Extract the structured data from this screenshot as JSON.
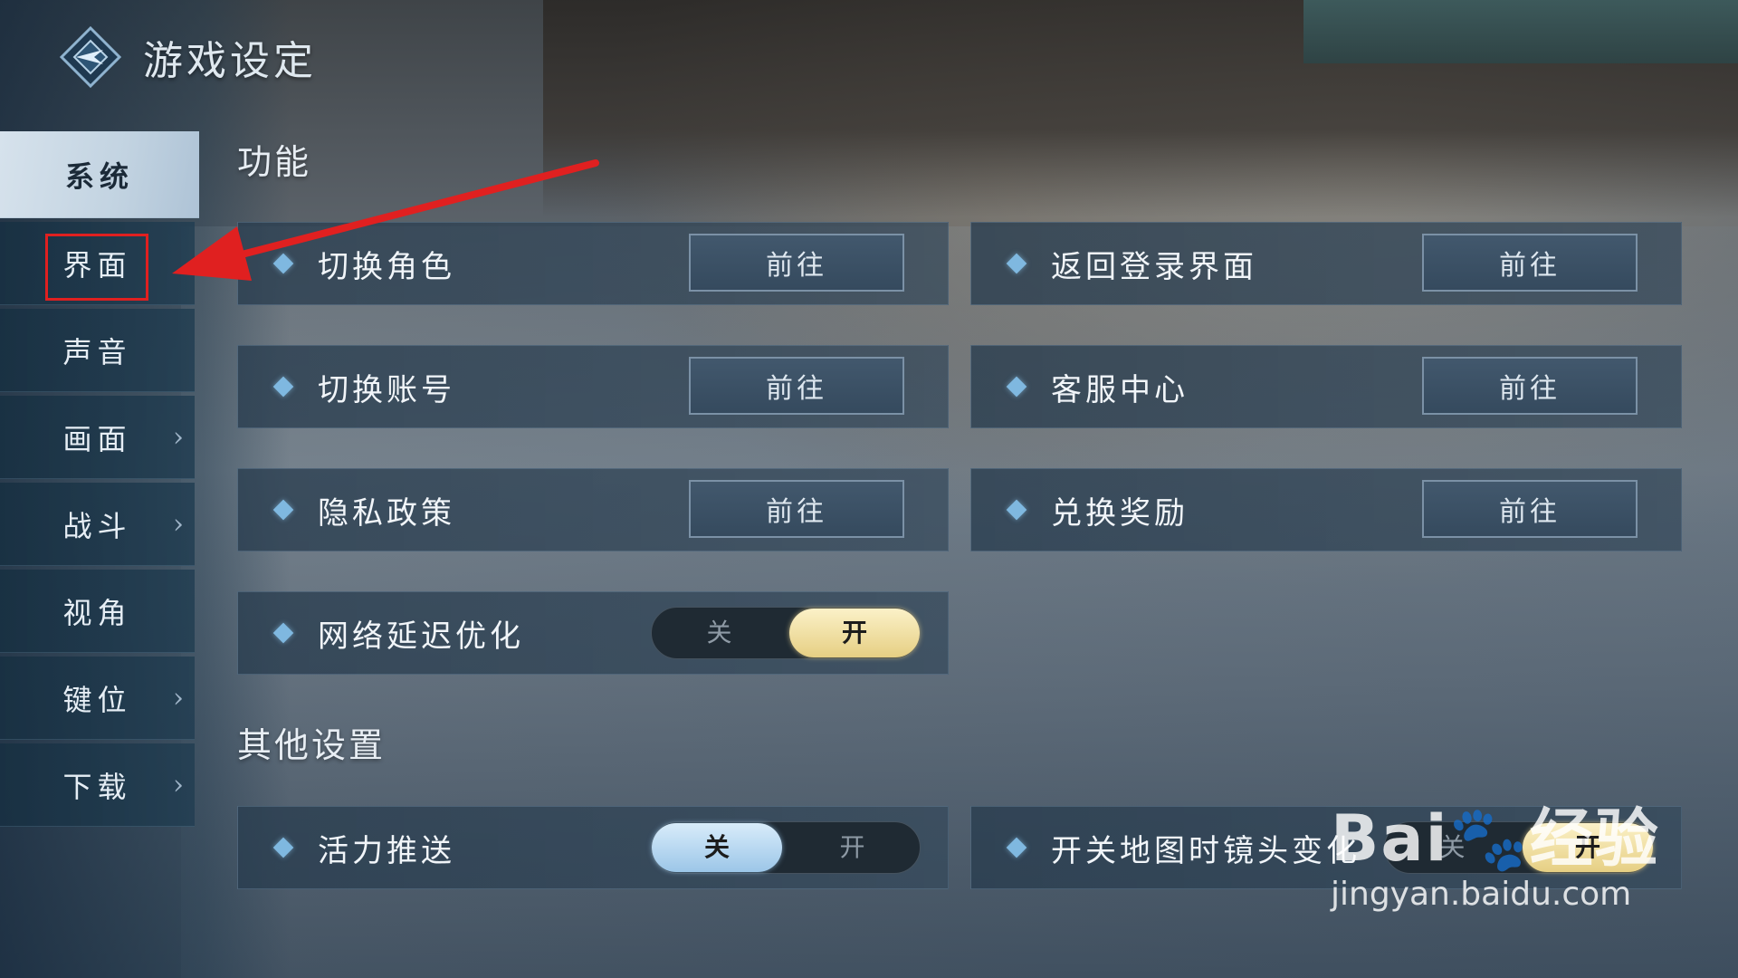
{
  "header": {
    "title": "游戏设定"
  },
  "sidebar": {
    "items": [
      {
        "label": "系统",
        "has_arrow": false
      },
      {
        "label": "界面",
        "has_arrow": false
      },
      {
        "label": "声音",
        "has_arrow": false
      },
      {
        "label": "画面",
        "has_arrow": true
      },
      {
        "label": "战斗",
        "has_arrow": true
      },
      {
        "label": "视角",
        "has_arrow": false
      },
      {
        "label": "键位",
        "has_arrow": true
      },
      {
        "label": "下载",
        "has_arrow": true
      }
    ],
    "active_index": 0,
    "chevron_glyph": "›"
  },
  "sections": {
    "function": {
      "title": "功能",
      "rows": [
        {
          "label": "切换角色",
          "button": "前往"
        },
        {
          "label": "返回登录界面",
          "button": "前往"
        },
        {
          "label": "切换账号",
          "button": "前往"
        },
        {
          "label": "客服中心",
          "button": "前往"
        },
        {
          "label": "隐私政策",
          "button": "前往"
        },
        {
          "label": "兑换奖励",
          "button": "前往"
        }
      ],
      "network": {
        "label": "网络延迟优化",
        "off": "关",
        "on": "开",
        "state": "on"
      }
    },
    "other": {
      "title": "其他设置",
      "vitality": {
        "label": "活力推送",
        "off": "关",
        "on": "开",
        "state": "off"
      },
      "map_camera": {
        "label": "开关地图时镜头变化",
        "off": "关",
        "on": "开",
        "state": "on"
      }
    }
  },
  "watermark": {
    "logo": "Bai🐾经验",
    "url": "jingyan.baidu.com"
  },
  "colors": {
    "annotation_red": "#e02020",
    "toggle_on_gold": "#e6cf83",
    "toggle_off_blue": "#9cc6e8"
  }
}
